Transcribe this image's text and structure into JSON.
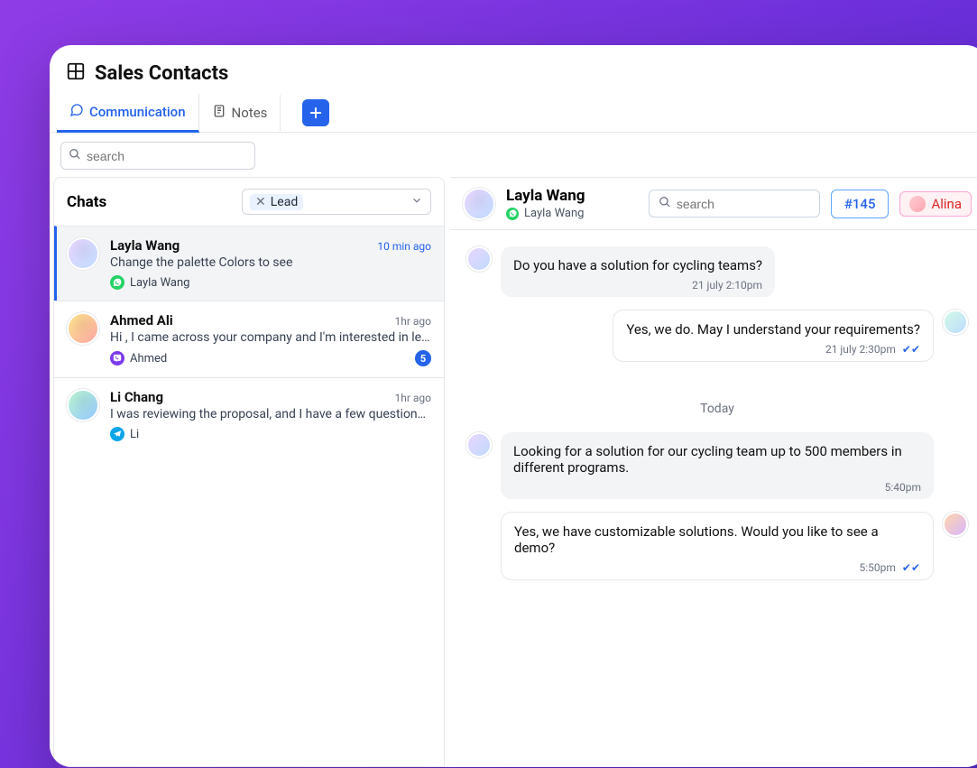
{
  "header": {
    "title": "Sales Contacts"
  },
  "tabs": {
    "communication": "Communication",
    "notes": "Notes"
  },
  "search": {
    "placeholder": "search"
  },
  "left": {
    "title": "Chats",
    "filter_tag": "Lead",
    "items": [
      {
        "name": "Layla Wang",
        "time": "10 min ago",
        "preview": "Change the palette Colors to see",
        "platform": "Layla Wang",
        "platform_type": "wa",
        "active": true
      },
      {
        "name": "Ahmed Ali",
        "time": "1hr ago",
        "preview": "Hi , I came across your company and I'm interested in learning m...",
        "platform": "Ahmed",
        "platform_type": "viber",
        "unread": "5"
      },
      {
        "name": "Li Chang",
        "time": "1hr ago",
        "preview": "I was reviewing the proposal, and I have a few questions about t...",
        "platform": "Li",
        "platform_type": "telegram"
      }
    ]
  },
  "conversation": {
    "name": "Layla Wang",
    "sub": "Layla Wang",
    "search_placeholder": "search",
    "ticket": "#145",
    "agent": "Alina",
    "divider": "Today",
    "messages": [
      {
        "from": "them",
        "text": "Do you have a solution for cycling teams?",
        "time": "21 july 2:10pm"
      },
      {
        "from": "me",
        "text": "Yes, we do. May I understand your requirements?",
        "time": "21 july 2:30pm",
        "ticks": true
      },
      {
        "divider": true
      },
      {
        "from": "them",
        "text": "Looking for a solution for our cycling team up to 500 members in different programs.",
        "time": "5:40pm"
      },
      {
        "from": "me",
        "text": "Yes, we have customizable solutions. Would you like to see a demo?",
        "time": "5:50pm",
        "ticks": true
      }
    ]
  }
}
